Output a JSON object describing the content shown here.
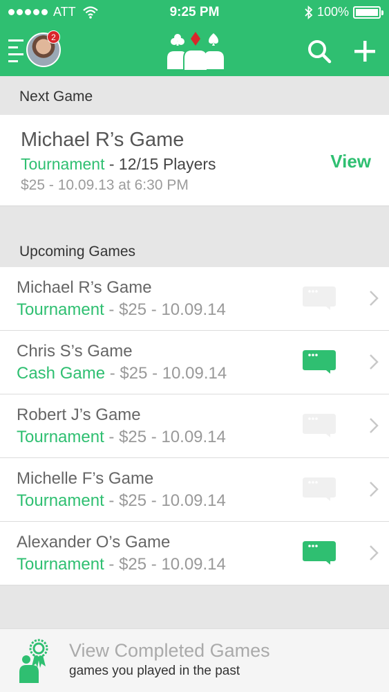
{
  "status_bar": {
    "carrier": "ATT",
    "time": "9:25 PM",
    "battery": "100%"
  },
  "navbar": {
    "notification_count": "2"
  },
  "next_game": {
    "header": "Next Game",
    "title": "Michael R’s Game",
    "type": "Tournament",
    "players": " - 12/15 Players",
    "meta": "$25 - 10.09.13 at 6:30 PM",
    "view_label": "View"
  },
  "upcoming": {
    "header": "Upcoming Games",
    "games": [
      {
        "name": "Michael R’s Game",
        "type": "Tournament",
        "detail": " - $25 - 10.09.14",
        "chat_active": false
      },
      {
        "name": "Chris S’s Game",
        "type": "Cash Game",
        "detail": " - $25 - 10.09.14",
        "chat_active": true
      },
      {
        "name": "Robert J’s Game",
        "type": "Tournament",
        "detail": " - $25 - 10.09.14",
        "chat_active": false
      },
      {
        "name": "Michelle F’s Game",
        "type": "Tournament",
        "detail": " - $25 - 10.09.14",
        "chat_active": false
      },
      {
        "name": "Alexander O’s Game",
        "type": "Tournament",
        "detail": " - $25 - 10.09.14",
        "chat_active": true
      }
    ]
  },
  "footer": {
    "title": "View Completed Games",
    "subtitle": "games you played in the past"
  },
  "colors": {
    "brand_green": "#2fbf71",
    "chat_inactive": "#f0f0f0",
    "badge_red": "#d9262b"
  }
}
